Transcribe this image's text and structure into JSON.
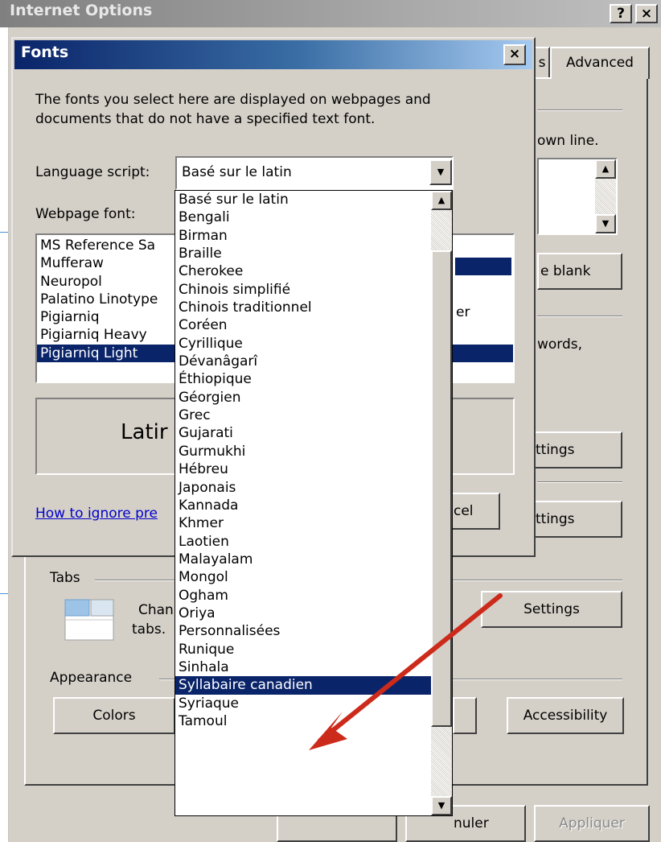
{
  "internet_options": {
    "title": "Internet Options",
    "help_button": "?",
    "close_button": "×",
    "tabs": {
      "partial": "s",
      "advanced": "Advanced"
    },
    "partial_text": {
      "own_line": "own line.",
      "be_blank": "e blank",
      "er": "er",
      "words": "words,",
      "settings_1": "ttings",
      "settings_2": "ttings",
      "cel": "cel"
    },
    "tabs_group": {
      "label": "Tabs",
      "text_line1": "Chan",
      "text_line2": "tabs.",
      "settings_button": "Settings"
    },
    "appearance_group": {
      "label": "Appearance",
      "colors_button": "Colors",
      "accessibility_button": "Accessibility"
    },
    "bottom_buttons": {
      "cancel": "nuler",
      "apply": "Appliquer"
    }
  },
  "fonts_dialog": {
    "title": "Fonts",
    "close_button": "×",
    "description": "The fonts you select here are displayed on webpages and documents that do not have a specified text font.",
    "language_script_label": "Language script:",
    "language_script_value": "Basé sur le latin",
    "webpage_font_label": "Webpage font:",
    "webpage_fonts": [
      "MS Reference Sa",
      "Mufferaw",
      "Neuropol",
      "Palatino Linotype",
      "Pigiarniq",
      "Pigiarniq Heavy",
      "Pigiarniq Light"
    ],
    "webpage_font_selected": "Pigiarniq Light",
    "preview_text": "Latir",
    "help_link": "How to ignore pre"
  },
  "language_dropdown": {
    "options": [
      "Basé sur le latin",
      "Bengali",
      "Birman",
      "Braille",
      "Cherokee",
      "Chinois simplifié",
      "Chinois traditionnel",
      "Coréen",
      "Cyrillique",
      "Dévanâgarî",
      "Éthiopique",
      "Géorgien",
      "Grec",
      "Gujarati",
      "Gurmukhi",
      "Hébreu",
      "Japonais",
      "Kannada",
      "Khmer",
      "Laotien",
      "Malayalam",
      "Mongol",
      "Ogham",
      "Oriya",
      "Personnalisées",
      "Runique",
      "Sinhala",
      "Syllabaire canadien",
      "Syriaque",
      "Tamoul"
    ],
    "selected": "Syllabaire canadien"
  },
  "annotation": {
    "arrow_color": "#cc2a1a"
  },
  "colors": {
    "titlebar_active": "#0a246a",
    "face": "#d4d0c8",
    "selection": "#0a246a",
    "link": "#0000cc"
  }
}
